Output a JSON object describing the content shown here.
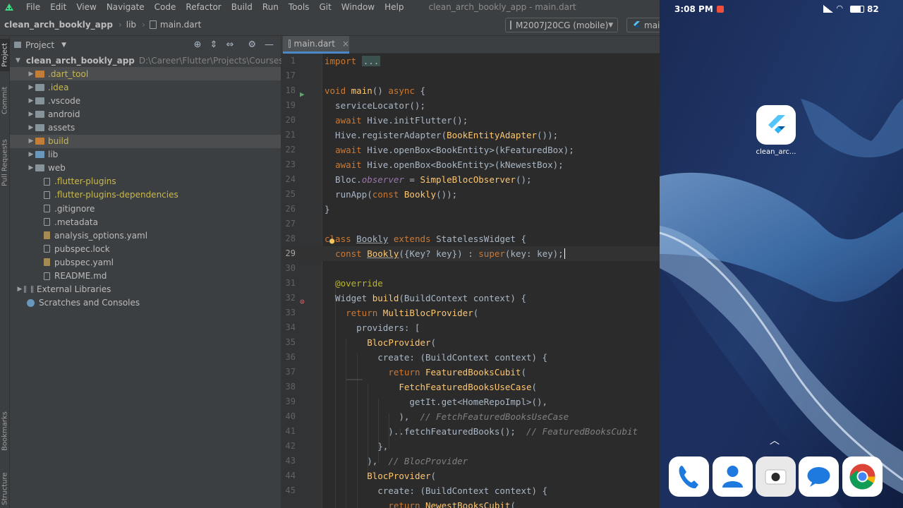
{
  "menu": {
    "items": [
      "File",
      "Edit",
      "View",
      "Navigate",
      "Code",
      "Refactor",
      "Build",
      "Run",
      "Tools",
      "Git",
      "Window",
      "Help"
    ],
    "window_title": "clean_arch_bookly_app - main.dart"
  },
  "nav": {
    "project": "clean_arch_bookly_app",
    "folder": "lib",
    "file": "main.dart",
    "device": "M2007J20CG (mobile)",
    "run_config": "mai"
  },
  "sidestrip": {
    "project": "Project",
    "commit": "Commit",
    "pull_requests": "Pull Requests",
    "bookmarks": "Bookmarks",
    "structure": "Structure"
  },
  "project_panel": {
    "title": "Project",
    "root": {
      "name": "clean_arch_bookly_app",
      "path": "D:\\Career\\Flutter\\Projects\\Courses Projects"
    },
    "items": [
      ".dart_tool",
      ".idea",
      ".vscode",
      "android",
      "assets",
      "build",
      "lib",
      "web",
      ".flutter-plugins",
      ".flutter-plugins-dependencies",
      ".gitignore",
      ".metadata",
      "analysis_options.yaml",
      "pubspec.lock",
      "pubspec.yaml",
      "README.md",
      "External Libraries",
      "Scratches and Consoles"
    ]
  },
  "editor": {
    "tab": "main.dart",
    "line_numbers": [
      "1",
      "17",
      "18",
      "19",
      "20",
      "21",
      "22",
      "23",
      "24",
      "25",
      "26",
      "27",
      "28",
      "29",
      "30",
      "31",
      "32",
      "33",
      "34",
      "35",
      "36",
      "37",
      "38",
      "39",
      "40",
      "41",
      "42",
      "43",
      "44",
      "45"
    ]
  },
  "phone": {
    "time": "3:08 PM",
    "battery": "82",
    "app_label": "clean_arc..."
  },
  "colors": {
    "keyword": "#cc7832",
    "function": "#ffc66d",
    "comment": "#808080",
    "annotation": "#bbb529",
    "excluded_folder": "#c27d38",
    "selection": "#4b4d4f"
  }
}
